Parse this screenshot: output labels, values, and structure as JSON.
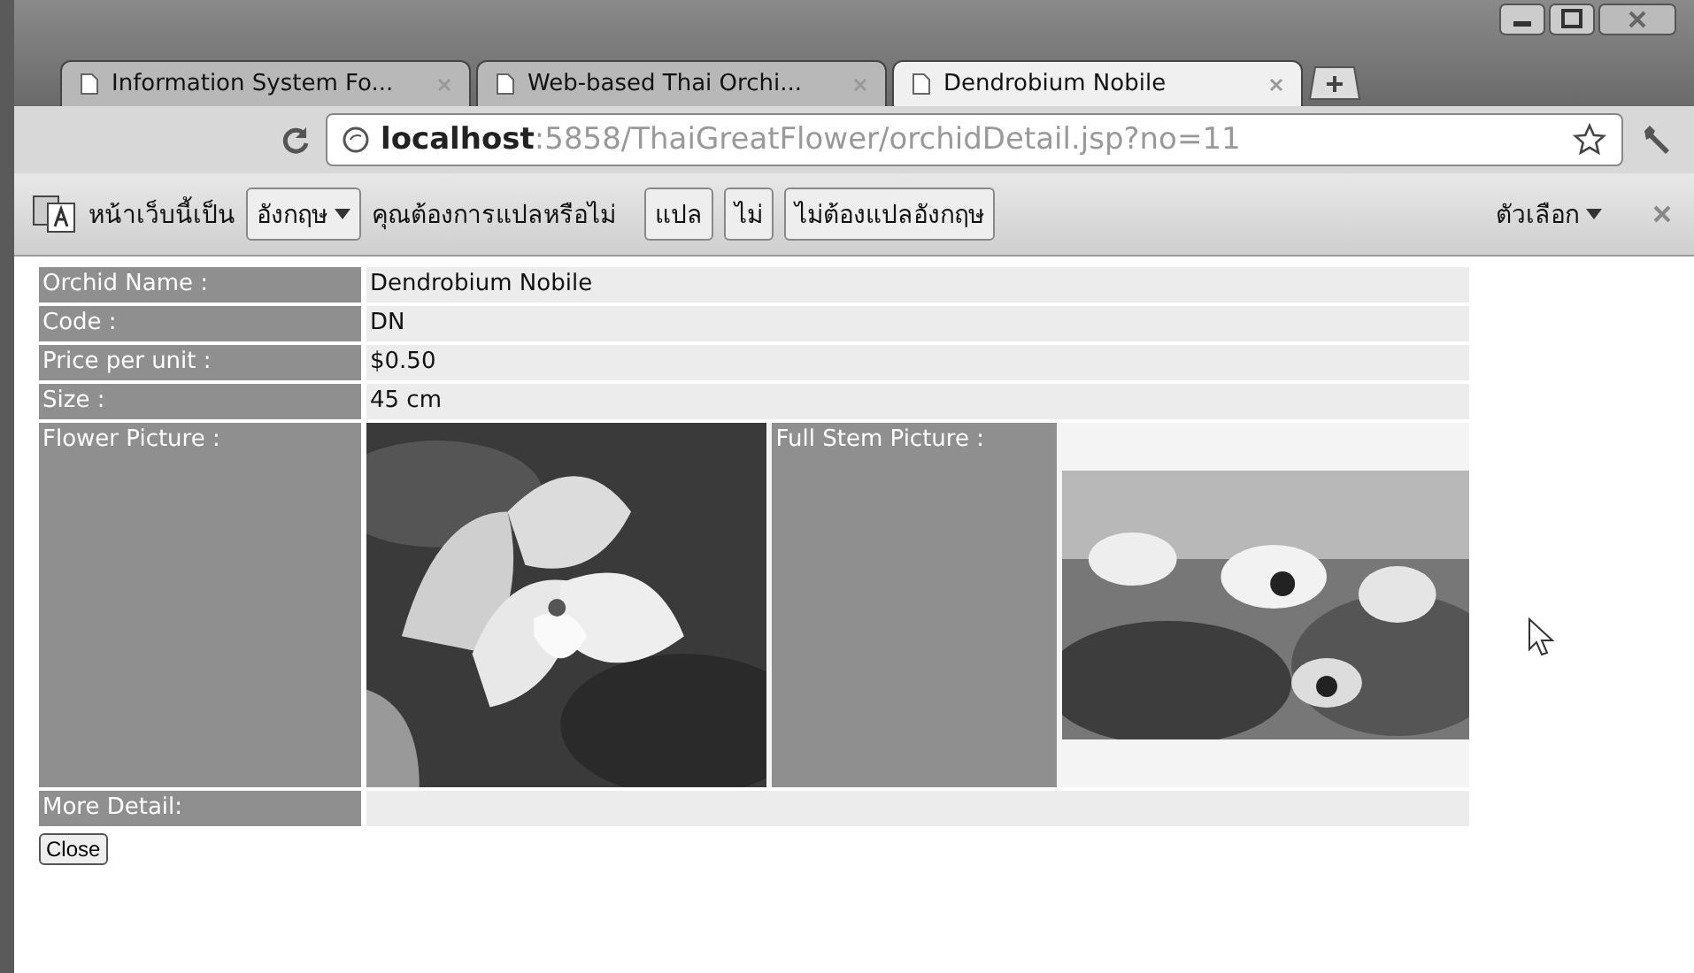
{
  "tabs": [
    {
      "title": "Information System Fo...",
      "selected": false
    },
    {
      "title": "Web-based Thai Orchi...",
      "selected": false
    },
    {
      "title": "Dendrobium Nobile",
      "selected": true
    }
  ],
  "address_bar": {
    "url": "**localhost**:5858/ThaiGreatFlower/orchidDetail.jsp?no=11"
  },
  "translate_bar": {
    "prefix": "หน้าเว็บนี้เป็น",
    "language": "อังกฤษ",
    "question": "คุณต้องการแปลหรือไม่",
    "buttons": [
      "แปล",
      "ไม่",
      "ไม่ต้องแปลอังกฤษ"
    ],
    "options": "ตัวเลือก"
  },
  "details": {
    "rows": [
      {
        "label": "Orchid Name :",
        "value": "Dendrobium Nobile"
      },
      {
        "label": "Code :",
        "value": "DN"
      },
      {
        "label": "Price per unit :",
        "value": "$0.50"
      },
      {
        "label": "Size :",
        "value": "45 cm"
      }
    ],
    "flower_picture_label": "Flower Picture :",
    "full_stem_picture_label": "Full Stem Picture :",
    "more_detail_label": "More Detail:"
  },
  "close_button": "Close"
}
